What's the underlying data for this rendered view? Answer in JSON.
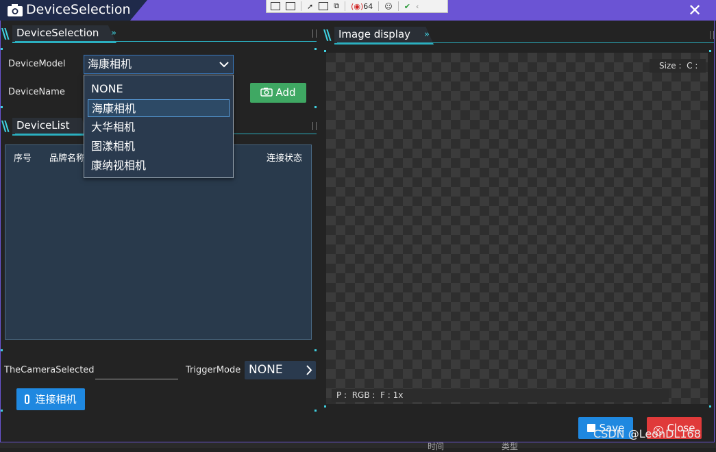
{
  "window": {
    "title": "DeviceSelection",
    "close_glyph": "✕"
  },
  "dev_toolbar": {
    "counter": "64"
  },
  "sections": {
    "device_selection": "DeviceSelection",
    "device_list": "DeviceList",
    "image_display": "Image display",
    "chevron": "»"
  },
  "form": {
    "device_model_label": "DeviceModel",
    "device_model_value": "海康相机",
    "device_name_label": "DeviceName",
    "add_button": "Add"
  },
  "dropdown": {
    "options": [
      "NONE",
      "海康相机",
      "大华相机",
      "图漾相机",
      "康纳视相机"
    ],
    "selected_index": 1
  },
  "device_table": {
    "columns": [
      "序号",
      "品牌名称",
      "连接状态"
    ]
  },
  "bottom": {
    "camera_selected_label": "TheCameraSelected",
    "trigger_mode_label": "TriggerMode",
    "trigger_mode_value": "NONE",
    "connect_button": "连接相机"
  },
  "image_display": {
    "size_text": "Size :  C :",
    "pixel_text": "P :  RGB :  F : 1x"
  },
  "footer": {
    "save_button": "Save",
    "close_button": "Close",
    "watermark": "CSDN @LeonDL168"
  },
  "bottom_strip": {
    "col1": "时间",
    "col2": "类型"
  },
  "colors": {
    "accent": "#3fd0e0",
    "titlebar": "#6b54d4",
    "add": "#3fa863",
    "primary": "#1f88e0",
    "danger": "#e03a3a"
  }
}
